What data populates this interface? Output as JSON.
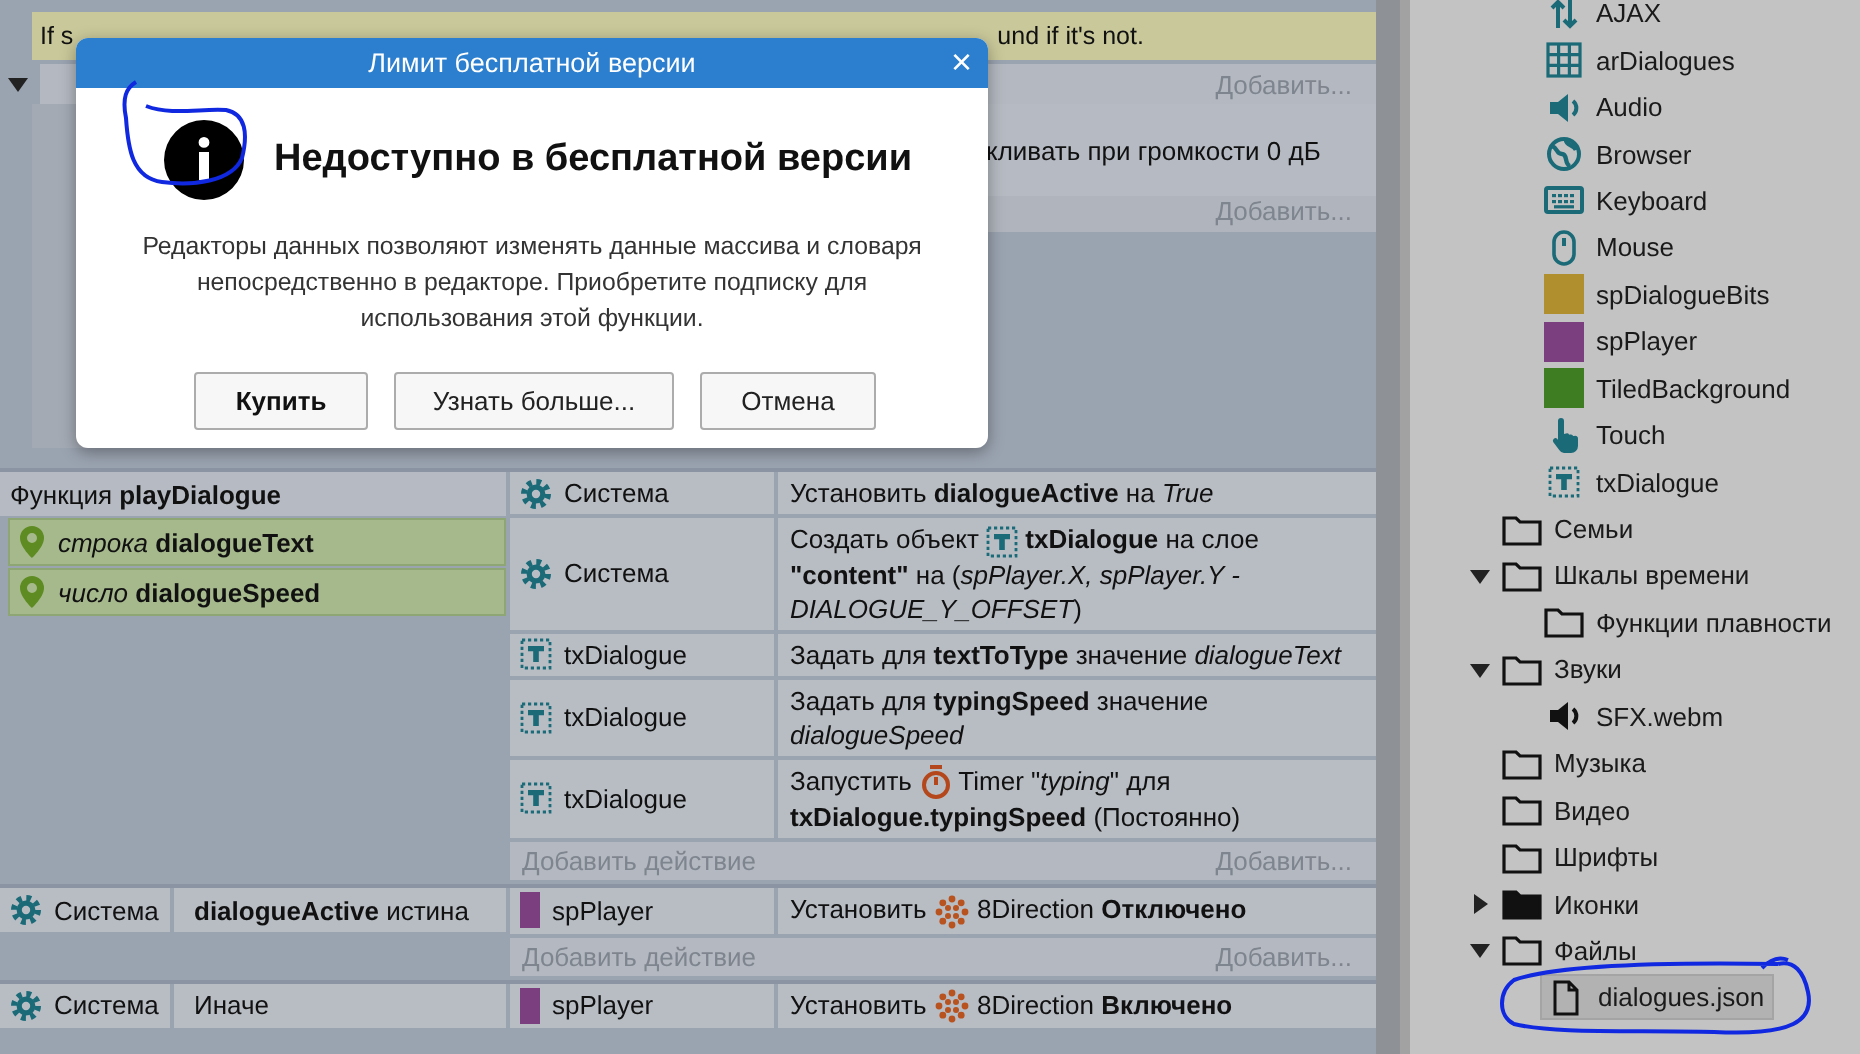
{
  "background": {
    "comment_start": "If s",
    "comment_end": "und if it's not.",
    "add_top": "Добавить...",
    "action_fragment": "кливать при громкости 0 дБ",
    "add_bottom": "Добавить..."
  },
  "dialog": {
    "title": "Лимит бесплатной версии",
    "close": "×",
    "heading": "Недоступно в бесплатной версии",
    "message": "Редакторы данных позволяют изменять данные массива и словаря непосредственно в редакторе. Приобретите подписку для использования этой функции.",
    "buttons": [
      {
        "label": "Купить",
        "default": true
      },
      {
        "label": "Узнать больше...",
        "default": false
      },
      {
        "label": "Отмена",
        "default": false
      }
    ]
  },
  "events": [
    {
      "kind": "function",
      "header": "Функция **playDialogue**",
      "params": [
        "*строка* **dialogueText**",
        "*число* **dialogueSpeed**"
      ],
      "actions": [
        {
          "kind": "system",
          "object": "Система",
          "segments": [
            {
              "kind": "text",
              "text": "Установить **dialogueActive** на *True*"
            }
          ]
        },
        {
          "kind": "system",
          "object": "Система",
          "segments": [
            {
              "kind": "text",
              "text": "Создать объект"
            },
            {
              "kind": "text-object-icon"
            },
            {
              "kind": "text",
              "text": "**txDialogue** на слое **\"content\"** на (*spPlayer.X, spPlayer.Y - DIALOGUE_Y_OFFSET*)"
            }
          ]
        },
        {
          "kind": "text-object",
          "object": "txDialogue",
          "segments": [
            {
              "kind": "text",
              "text": "Задать для **textToType** значение *dialogueText*"
            }
          ]
        },
        {
          "kind": "text-object",
          "object": "txDialogue",
          "segments": [
            {
              "kind": "text",
              "text": "Задать для **typingSpeed** значение *dialogueSpeed*"
            }
          ]
        },
        {
          "kind": "text-object",
          "object": "txDialogue",
          "segments": [
            {
              "kind": "text",
              "text": "Запустить"
            },
            {
              "kind": "timer-icon"
            },
            {
              "kind": "text",
              "text": "Timer \"*typing*\" для **txDialogue.typingSpeed** (Постоянно)"
            }
          ]
        }
      ],
      "add_action": "Добавить действие",
      "add_more": "Добавить..."
    },
    {
      "kind": "condition",
      "condition": {
        "kind": "system",
        "object": "Система",
        "text": "**dialogueActive** истина"
      },
      "actions": [
        {
          "kind": "sprite",
          "object": "spPlayer",
          "color": "#7b3f80",
          "segments": [
            {
              "kind": "text",
              "text": "Установить"
            },
            {
              "kind": "behavior-icon"
            },
            {
              "kind": "text",
              "text": "8Direction **Отключено**"
            }
          ]
        }
      ],
      "add_action": "Добавить действие",
      "add_more": "Добавить..."
    },
    {
      "kind": "condition",
      "condition": {
        "kind": "system",
        "object": "Система",
        "text": "Иначе"
      },
      "actions": [
        {
          "kind": "sprite",
          "object": "spPlayer",
          "color": "#7b3f80",
          "segments": [
            {
              "kind": "text",
              "text": "Установить"
            },
            {
              "kind": "behavior-icon"
            },
            {
              "kind": "text",
              "text": "8Direction **Включено**"
            }
          ]
        }
      ]
    }
  ],
  "project_tree": {
    "objects": [
      {
        "label": "AJAX",
        "kind": "ajax",
        "selected": false
      },
      {
        "label": "arDialogues",
        "kind": "array",
        "selected": false
      },
      {
        "label": "Audio",
        "kind": "audio",
        "selected": false
      },
      {
        "label": "Browser",
        "kind": "browser",
        "selected": false
      },
      {
        "label": "Keyboard",
        "kind": "keyboard",
        "selected": false
      },
      {
        "label": "Mouse",
        "kind": "mouse",
        "selected": false
      },
      {
        "label": "spDialogueBits",
        "kind": "sprite",
        "color": "#b08f2e",
        "selected": false
      },
      {
        "label": "spPlayer",
        "kind": "sprite",
        "color": "#7b3f80",
        "selected": false
      },
      {
        "label": "TiledBackground",
        "kind": "sprite",
        "color": "#3f7d22",
        "selected": false
      },
      {
        "label": "Touch",
        "kind": "touch",
        "selected": false
      },
      {
        "label": "txDialogue",
        "kind": "text-object",
        "selected": false
      }
    ],
    "folders": [
      {
        "label": "Семьи",
        "kind": "folder",
        "selected": false
      },
      {
        "label": "Шкалы времени",
        "kind": "folder",
        "expanded": true,
        "selected": false,
        "children": [
          {
            "label": "Функции плавности",
            "kind": "folder",
            "selected": false
          }
        ]
      },
      {
        "label": "Звуки",
        "kind": "folder",
        "expanded": true,
        "selected": false,
        "children": [
          {
            "label": "SFX.webm",
            "kind": "sound",
            "selected": false
          }
        ]
      },
      {
        "label": "Музыка",
        "kind": "folder",
        "selected": false
      },
      {
        "label": "Видео",
        "kind": "folder",
        "selected": false
      },
      {
        "label": "Шрифты",
        "kind": "folder",
        "selected": false
      },
      {
        "label": "Иконки",
        "kind": "folder",
        "expanded": false,
        "selected": false
      },
      {
        "label": "Файлы",
        "kind": "folder",
        "expanded": true,
        "selected": false,
        "children": [
          {
            "label": "dialogues.json",
            "kind": "file",
            "selected": true
          }
        ]
      }
    ]
  }
}
